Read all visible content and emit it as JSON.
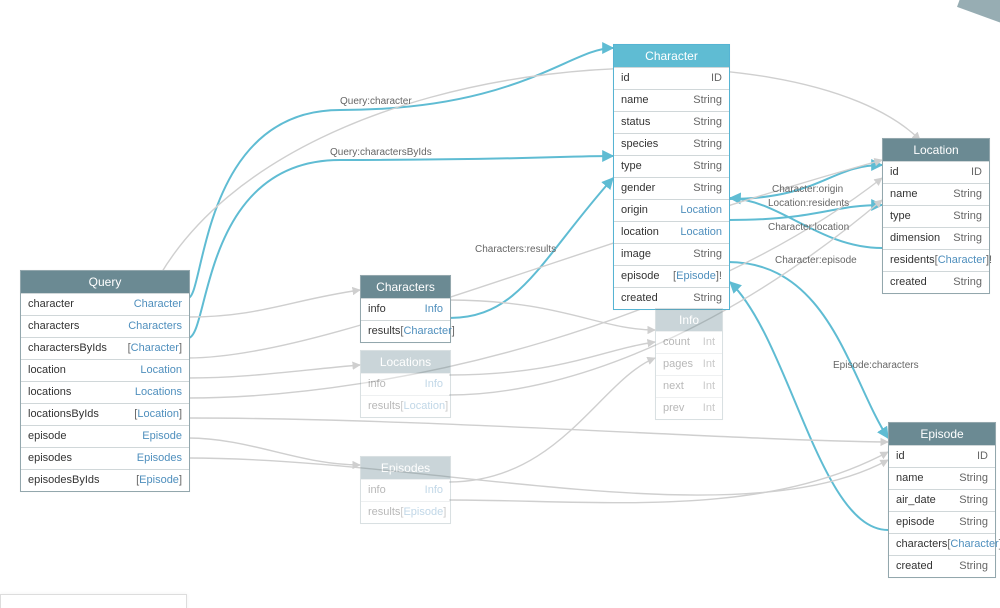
{
  "entities": {
    "query": {
      "title": "Query",
      "fields": [
        {
          "name": "character",
          "type": "Character",
          "link": true
        },
        {
          "name": "characters",
          "type": "Characters",
          "link": true
        },
        {
          "name": "charactersByIds",
          "type": "[Character]",
          "link": true
        },
        {
          "name": "location",
          "type": "Location",
          "link": true
        },
        {
          "name": "locations",
          "type": "Locations",
          "link": true
        },
        {
          "name": "locationsByIds",
          "type": "[Location]",
          "link": true
        },
        {
          "name": "episode",
          "type": "Episode",
          "link": true
        },
        {
          "name": "episodes",
          "type": "Episodes",
          "link": true
        },
        {
          "name": "episodesByIds",
          "type": "[Episode]",
          "link": true
        }
      ]
    },
    "characters": {
      "title": "Characters",
      "fields": [
        {
          "name": "info",
          "type": "Info",
          "link": true
        },
        {
          "name": "results",
          "type": "[Character]",
          "link": true
        }
      ]
    },
    "locations": {
      "title": "Locations",
      "fields": [
        {
          "name": "info",
          "type": "Info",
          "link": true
        },
        {
          "name": "results",
          "type": "[Location]",
          "link": true
        }
      ]
    },
    "episodes": {
      "title": "Episodes",
      "fields": [
        {
          "name": "info",
          "type": "Info",
          "link": true
        },
        {
          "name": "results",
          "type": "[Episode]",
          "link": true
        }
      ]
    },
    "character": {
      "title": "Character",
      "fields": [
        {
          "name": "id",
          "type": "ID"
        },
        {
          "name": "name",
          "type": "String"
        },
        {
          "name": "status",
          "type": "String"
        },
        {
          "name": "species",
          "type": "String"
        },
        {
          "name": "type",
          "type": "String"
        },
        {
          "name": "gender",
          "type": "String"
        },
        {
          "name": "origin",
          "type": "Location",
          "link": true
        },
        {
          "name": "location",
          "type": "Location",
          "link": true
        },
        {
          "name": "image",
          "type": "String"
        },
        {
          "name": "episode",
          "type": "[Episode]!",
          "link": true
        },
        {
          "name": "created",
          "type": "String"
        }
      ]
    },
    "info": {
      "title": "Info",
      "fields": [
        {
          "name": "count",
          "type": "Int"
        },
        {
          "name": "pages",
          "type": "Int"
        },
        {
          "name": "next",
          "type": "Int"
        },
        {
          "name": "prev",
          "type": "Int"
        }
      ]
    },
    "location": {
      "title": "Location",
      "fields": [
        {
          "name": "id",
          "type": "ID"
        },
        {
          "name": "name",
          "type": "String"
        },
        {
          "name": "type",
          "type": "String"
        },
        {
          "name": "dimension",
          "type": "String"
        },
        {
          "name": "residents",
          "type": "[Character]!",
          "link": true
        },
        {
          "name": "created",
          "type": "String"
        }
      ]
    },
    "episode": {
      "title": "Episode",
      "fields": [
        {
          "name": "id",
          "type": "ID"
        },
        {
          "name": "name",
          "type": "String"
        },
        {
          "name": "air_date",
          "type": "String"
        },
        {
          "name": "episode",
          "type": "String"
        },
        {
          "name": "characters",
          "type": "[Character]!",
          "link": true
        },
        {
          "name": "created",
          "type": "String"
        }
      ]
    }
  },
  "edgeLabels": {
    "queryCharacter": "Query:character",
    "queryCharactersByIds": "Query:charactersByIds",
    "charactersResults": "Characters:results",
    "characterOrigin": "Character:origin",
    "locationResidents": "Location:residents",
    "characterLocation": "Character:location",
    "characterEpisode": "Character:episode",
    "episodeCharacters": "Episode:characters"
  }
}
